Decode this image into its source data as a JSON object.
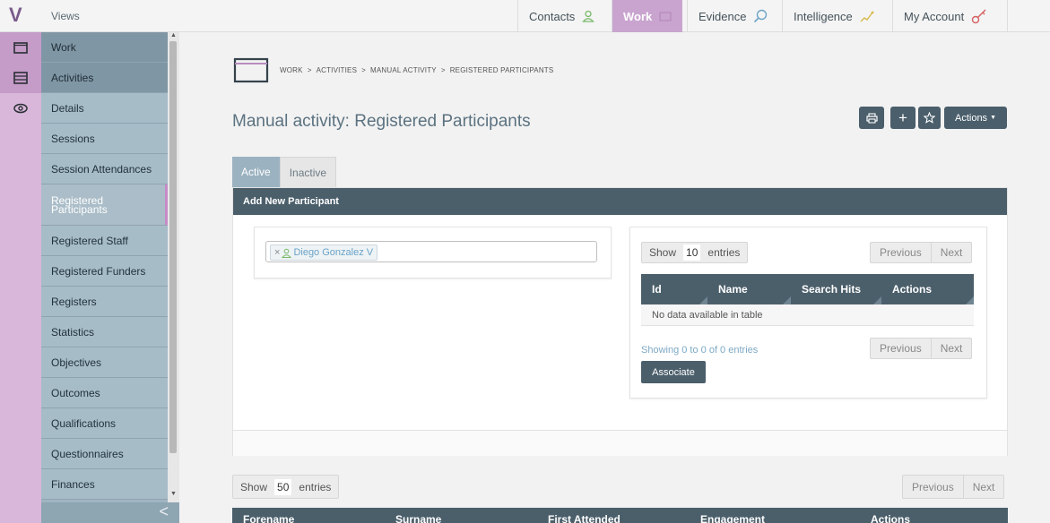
{
  "sidebar": {
    "logo": "V",
    "views_label": "Views",
    "items": [
      {
        "label": "Work",
        "variant": "dark"
      },
      {
        "label": "Activities",
        "variant": "dark"
      },
      {
        "label": "Details",
        "variant": "normal"
      },
      {
        "label": "Sessions",
        "variant": "normal"
      },
      {
        "label": "Session Attendances",
        "variant": "normal"
      },
      {
        "label": "Registered Participants",
        "variant": "active"
      },
      {
        "label": "Registered Staff",
        "variant": "normal"
      },
      {
        "label": "Registered Funders",
        "variant": "normal"
      },
      {
        "label": "Registers",
        "variant": "normal"
      },
      {
        "label": "Statistics",
        "variant": "normal"
      },
      {
        "label": "Objectives",
        "variant": "normal"
      },
      {
        "label": "Outcomes",
        "variant": "normal"
      },
      {
        "label": "Qualifications",
        "variant": "normal"
      },
      {
        "label": "Questionnaires",
        "variant": "normal"
      },
      {
        "label": "Finances",
        "variant": "normal"
      }
    ],
    "collapse_glyph": "<"
  },
  "topnav": {
    "contacts": "Contacts",
    "work": "Work",
    "evidence": "Evidence",
    "intelligence": "Intelligence",
    "account": "My Account"
  },
  "breadcrumb": {
    "items": [
      "WORK",
      "ACTIVITIES",
      "MANUAL ACTIVITY",
      "REGISTERED PARTICIPANTS"
    ],
    "separator": ">"
  },
  "page": {
    "title": "Manual activity: Registered Participants",
    "actions_label": "Actions"
  },
  "tabs": {
    "active": "Active",
    "inactive": "Inactive"
  },
  "panel": {
    "title": "Add New Participant"
  },
  "participant_select": {
    "chip_remove": "×",
    "chip_label": "Diego Gonzalez V"
  },
  "search_table": {
    "show_label": "Show",
    "show_value": "10",
    "entries_label": "entries",
    "prev": "Previous",
    "next": "Next",
    "columns": [
      "Id",
      "Name",
      "Search Hits",
      "Actions"
    ],
    "empty": "No data available in table",
    "info": "Showing 0 to 0 of 0 entries",
    "associate": "Associate"
  },
  "main_table": {
    "show_label": "Show",
    "show_value": "50",
    "entries_label": "entries",
    "prev": "Previous",
    "next": "Next",
    "columns": [
      "Forename",
      "Surname",
      "First Attended",
      "Engagement",
      "Actions"
    ]
  },
  "colors": {
    "accent": "#c9a4cf",
    "header_dark": "#4b5f6b",
    "sidebar": "#a6bcc7",
    "link": "#7da9c4"
  }
}
